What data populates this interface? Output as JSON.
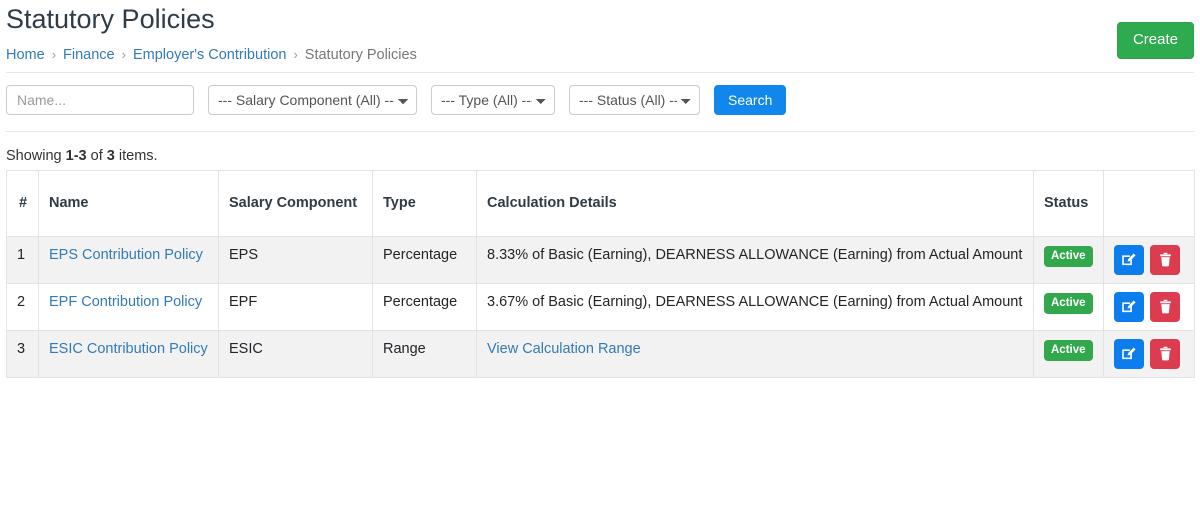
{
  "header": {
    "title": "Statutory Policies",
    "create_label": "Create",
    "breadcrumb": [
      {
        "label": "Home",
        "active": false
      },
      {
        "label": "Finance",
        "active": false
      },
      {
        "label": "Employer's Contribution",
        "active": false
      },
      {
        "label": "Statutory Policies",
        "active": true
      }
    ],
    "breadcrumb_separator": "›"
  },
  "filters": {
    "name_placeholder": "Name...",
    "name_value": "",
    "salary_component_selected": "--- Salary Component (All) ---",
    "type_selected": "--- Type (All) ---",
    "status_selected": "--- Status (All) ---",
    "search_label": "Search"
  },
  "summary": {
    "prefix": "Showing ",
    "range": "1-3",
    "middle": " of ",
    "total": "3",
    "suffix": " items."
  },
  "table": {
    "columns": [
      "#",
      "Name",
      "Salary Component",
      "Type",
      "Calculation Details",
      "Status",
      ""
    ],
    "rows": [
      {
        "num": "1",
        "name": "EPS Contribution Policy",
        "salary_component": "EPS",
        "type": "Percentage",
        "calculation": "8.33% of Basic (Earning), DEARNESS ALLOWANCE (Earning) from Actual Amount",
        "calculation_is_link": false,
        "status": "Active"
      },
      {
        "num": "2",
        "name": "EPF Contribution Policy",
        "salary_component": "EPF",
        "type": "Percentage",
        "calculation": "3.67% of Basic (Earning), DEARNESS ALLOWANCE (Earning) from Actual Amount",
        "calculation_is_link": false,
        "status": "Active"
      },
      {
        "num": "3",
        "name": "ESIC Contribution Policy",
        "salary_component": "ESIC",
        "type": "Range",
        "calculation": "View Calculation Range",
        "calculation_is_link": true,
        "status": "Active"
      }
    ]
  },
  "colors": {
    "create_green": "#2eab4f",
    "search_blue": "#1186ec",
    "link_blue": "#337ab7",
    "badge_green": "#31a84b",
    "edit_blue": "#0b7ded",
    "delete_red": "#dc3c50",
    "row_stripe": "#f2f2f2",
    "border": "#e3e3e3"
  },
  "icons": {
    "edit": "pen-to-square-icon",
    "delete": "trash-icon"
  }
}
